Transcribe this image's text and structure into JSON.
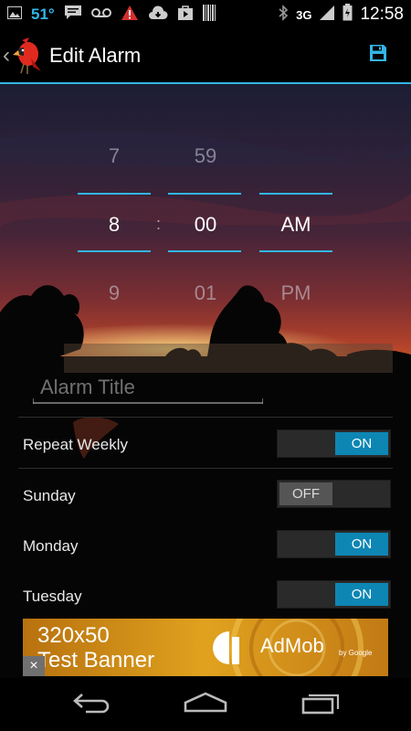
{
  "status_bar": {
    "temperature": "51°",
    "network": "3G",
    "time": "12:58",
    "icons": [
      "image-icon",
      "chat-icon",
      "voicemail-icon",
      "warning-icon",
      "cloud-download-icon",
      "play-store-icon",
      "barcode-icon",
      "bluetooth-icon",
      "signal-icon",
      "battery-icon"
    ]
  },
  "action_bar": {
    "title": "Edit Alarm",
    "save_icon": "save-icon",
    "accent": "#33b5e5"
  },
  "time_picker": {
    "hour": {
      "prev": "7",
      "current": "8",
      "next": "9"
    },
    "separator": ":",
    "minute": {
      "prev": "59",
      "current": "00",
      "next": "01"
    },
    "ampm": {
      "current": "AM",
      "next": "PM"
    }
  },
  "alarm_title": {
    "placeholder": "Alarm Title",
    "value": ""
  },
  "settings": {
    "repeat_weekly": {
      "label": "Repeat Weekly",
      "state": "ON"
    },
    "days": [
      {
        "label": "Sunday",
        "state": "OFF"
      },
      {
        "label": "Monday",
        "state": "ON"
      },
      {
        "label": "Tuesday",
        "state": "ON"
      }
    ]
  },
  "ad_banner": {
    "line1": "320x50",
    "line2": "Test Banner",
    "brand": "AdMob",
    "by": "by Google",
    "close": "×"
  },
  "nav_bar": {
    "icons": [
      "back-icon",
      "home-icon",
      "recent-apps-icon"
    ]
  },
  "colors": {
    "toggle_on": "#0e86b4",
    "toggle_off": "#555555"
  }
}
